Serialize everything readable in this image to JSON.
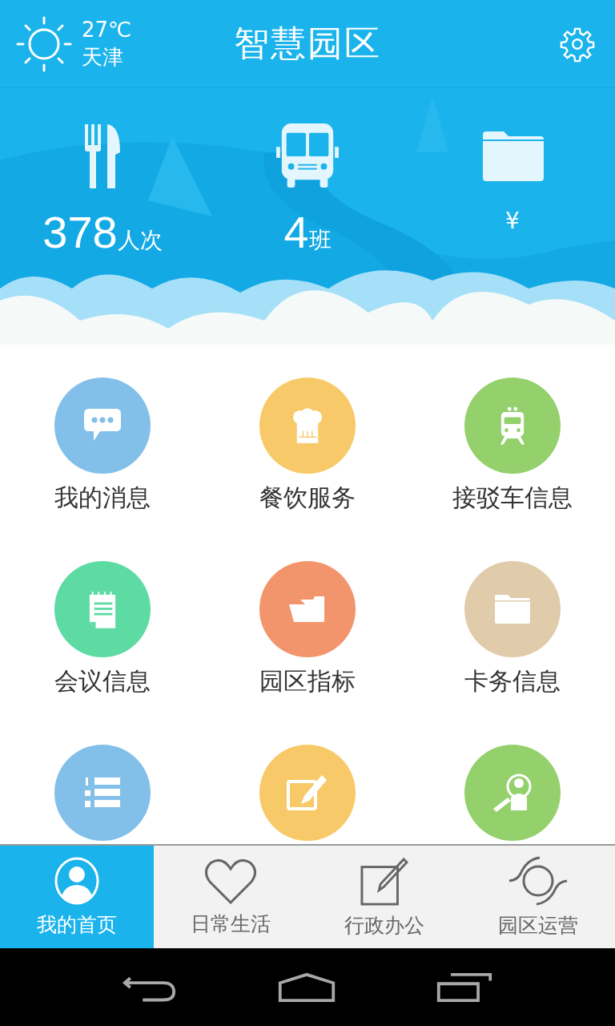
{
  "header": {
    "temperature": "27℃",
    "city": "天津",
    "title": "智慧园区"
  },
  "stats": [
    {
      "kind": "dining",
      "value": "378",
      "unit": "人次"
    },
    {
      "kind": "bus",
      "value": "4",
      "unit": "班"
    },
    {
      "kind": "folder",
      "unit": "¥"
    }
  ],
  "tiles": [
    {
      "kind": "chat",
      "label": "我的消息",
      "color": "#82c0ea"
    },
    {
      "kind": "chef",
      "label": "餐饮服务",
      "color": "#f8c968"
    },
    {
      "kind": "train",
      "label": "接驳车信息",
      "color": "#94d06c"
    },
    {
      "kind": "notepad",
      "label": "会议信息",
      "color": "#5ddba3"
    },
    {
      "kind": "open-folder",
      "label": "园区指标",
      "color": "#f2956c"
    },
    {
      "kind": "folder",
      "label": "卡务信息",
      "color": "#e0cbaa"
    },
    {
      "kind": "list",
      "color": "#82c0ea"
    },
    {
      "kind": "edit",
      "color": "#f8c968"
    },
    {
      "kind": "search-person",
      "color": "#94d06c"
    }
  ],
  "tabs": [
    {
      "kind": "person",
      "label": "我的首页",
      "selected": true
    },
    {
      "kind": "heart",
      "label": "日常生活",
      "selected": false
    },
    {
      "kind": "edit",
      "label": "行政办公",
      "selected": false
    },
    {
      "kind": "cycle",
      "label": "园区运营",
      "selected": false
    }
  ]
}
